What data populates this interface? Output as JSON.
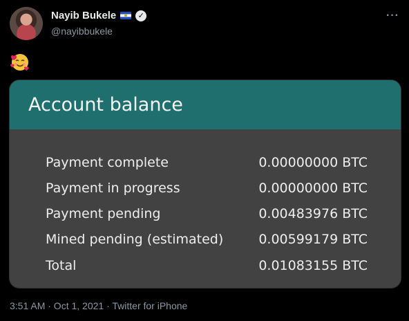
{
  "tweet": {
    "author_name": "Nayib Bukele",
    "handle": "@nayibbukele",
    "more_label": "···",
    "verified_mark": "✓",
    "emoji_label": "smiling face with hearts",
    "timestamp": "3:51 AM · Oct 1, 2021 · Twitter for iPhone"
  },
  "card": {
    "title": "Account balance",
    "rows": [
      {
        "label": "Payment complete",
        "value": "0.00000000 BTC"
      },
      {
        "label": "Payment in progress",
        "value": "0.00000000 BTC"
      },
      {
        "label": "Payment pending",
        "value": "0.00483976 BTC"
      },
      {
        "label": "Mined pending (estimated)",
        "value": "0.00599179 BTC"
      },
      {
        "label": "Total",
        "value": "0.01083155 BTC"
      }
    ]
  },
  "colors": {
    "background": "#000000",
    "card_header": "#1f6f6e",
    "card_body": "#424242"
  },
  "icons": [
    "avatar",
    "el-salvador-flag-icon",
    "verified-badge-icon",
    "more-options-icon",
    "smiling-face-with-hearts-emoji"
  ]
}
